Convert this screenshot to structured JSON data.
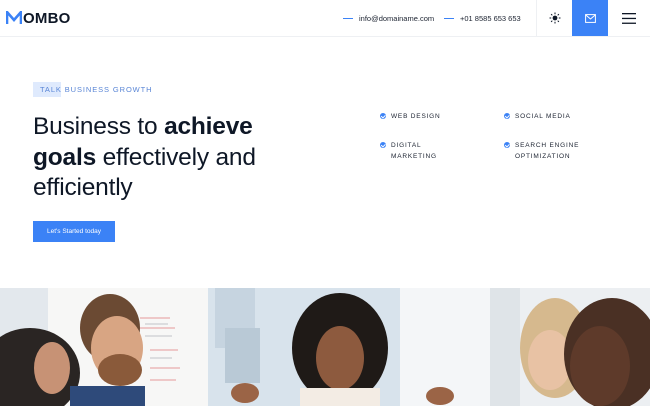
{
  "header": {
    "logo_text": "OMBO",
    "email": "info@domainame.com",
    "phone": "+01 8585 653 653",
    "icons": [
      "sun-icon",
      "mail-icon",
      "hamburger-menu-icon"
    ]
  },
  "hero": {
    "tag": "TALK BUSINESS GROWTH",
    "headline": {
      "part1": "Business to ",
      "bold1": "achieve",
      "bold2": "goals",
      "part2": " effectively and efficiently"
    },
    "cta_label": "Let's Started today",
    "features": [
      "WEB DESIGN",
      "SOCIAL MEDIA",
      "DIGITAL MARKETING",
      "SEARCH ENGINE OPTIMIZATION"
    ]
  },
  "colors": {
    "accent": "#3b82f6",
    "text_dark": "#0e1726",
    "tag_bg": "#dfeafd"
  }
}
